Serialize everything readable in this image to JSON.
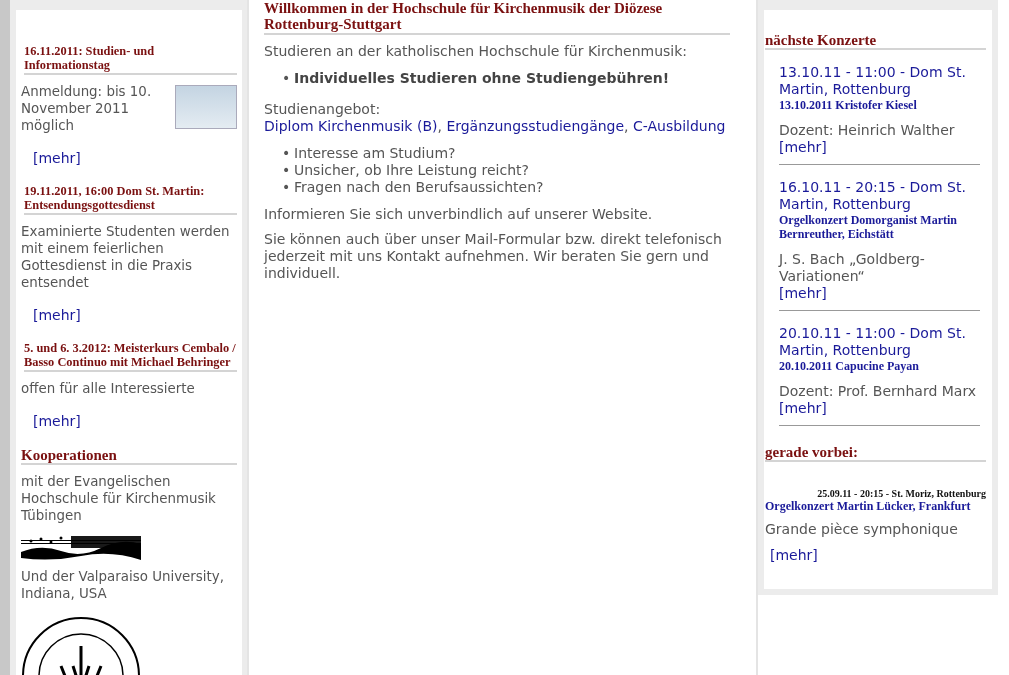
{
  "left": {
    "news": [
      {
        "title": "16.11.2011: Studien- und Informationstag",
        "text": "Anmeldung: bis 10. November 2011 möglich",
        "has_image": true,
        "more": "[mehr]"
      },
      {
        "title": "19.11.2011, 16:00 Dom St. Martin: Entsendungsgottesdienst",
        "text": "Examinierte Studenten werden mit einem feierlichen Gottesdienst in die Praxis entsendet",
        "has_image": false,
        "more": "[mehr]"
      },
      {
        "title": "5. und 6. 3.2012: Meisterkurs Cembalo / Basso Continuo mit Michael Behringer",
        "text": "offen für alle Interessierte",
        "has_image": false,
        "more": "[mehr]"
      }
    ],
    "cooperations": {
      "heading": "Kooperationen",
      "items": [
        {
          "text": "mit der Evangelischen Hochschule für Kirchenmusik Tübingen",
          "kind": "music"
        },
        {
          "text": "Und der Valparaiso University, Indiana, USA",
          "kind": "seal"
        }
      ]
    }
  },
  "main": {
    "title": "Willkommen in der Hochschule für Kirchenmusik der Diözese Rottenburg-Stuttgart",
    "intro": "Studieren an der katholischen Hochschule für Kirchenmusik:",
    "highlight": "Individuelles Studieren ohne Studiengebühren!",
    "offer_label": "Studienangebot:",
    "bullet": "•",
    "offer_separator": ",",
    "offer_links": [
      "Diplom Kirchenmusik (B)",
      "Ergänzungsstudiengänge",
      "C-Ausbildung"
    ],
    "questions": [
      "Interesse am Studium?",
      "Unsicher, ob Ihre Leistung reicht?",
      "Fragen nach den Berufsaussichten?"
    ],
    "paragraphs": [
      "Informieren Sie sich unverbindlich auf unserer Website.",
      "Sie können auch über unser Mail-Formular bzw. direkt telefonisch jederzeit mit uns Kontakt aufnehmen. Wir beraten Sie gern und individuell."
    ]
  },
  "right": {
    "upcoming_heading": "nächste Konzerte",
    "concerts": [
      {
        "when": "13.10.11 - 11:00 - Dom St. Martin, Rottenburg",
        "title": "13.10.2011 Kristofer Kiesel",
        "text": "Dozent: Heinrich Walther",
        "more": "[mehr]"
      },
      {
        "when": "16.10.11 - 20:15 - Dom St. Martin, Rottenburg",
        "title": "Orgelkonzert Domorganist Martin Bernreuther, Eichstätt",
        "text": "J. S. Bach „Goldberg-Variationen“",
        "more": "[mehr]"
      },
      {
        "when": "20.10.11 - 11:00 - Dom St. Martin, Rottenburg",
        "title": "20.10.2011 Capucine Payan",
        "text": "Dozent: Prof. Bernhard Marx",
        "more": "[mehr]"
      }
    ],
    "past_heading": "gerade vorbei:",
    "past": {
      "when": "25.09.11 - 20:15 - St. Moriz, Rottenburg",
      "title": "Orgelkonzert Martin Lücker, Frankfurt",
      "text": "Grande pièce symphonique",
      "more": "[mehr]"
    }
  }
}
